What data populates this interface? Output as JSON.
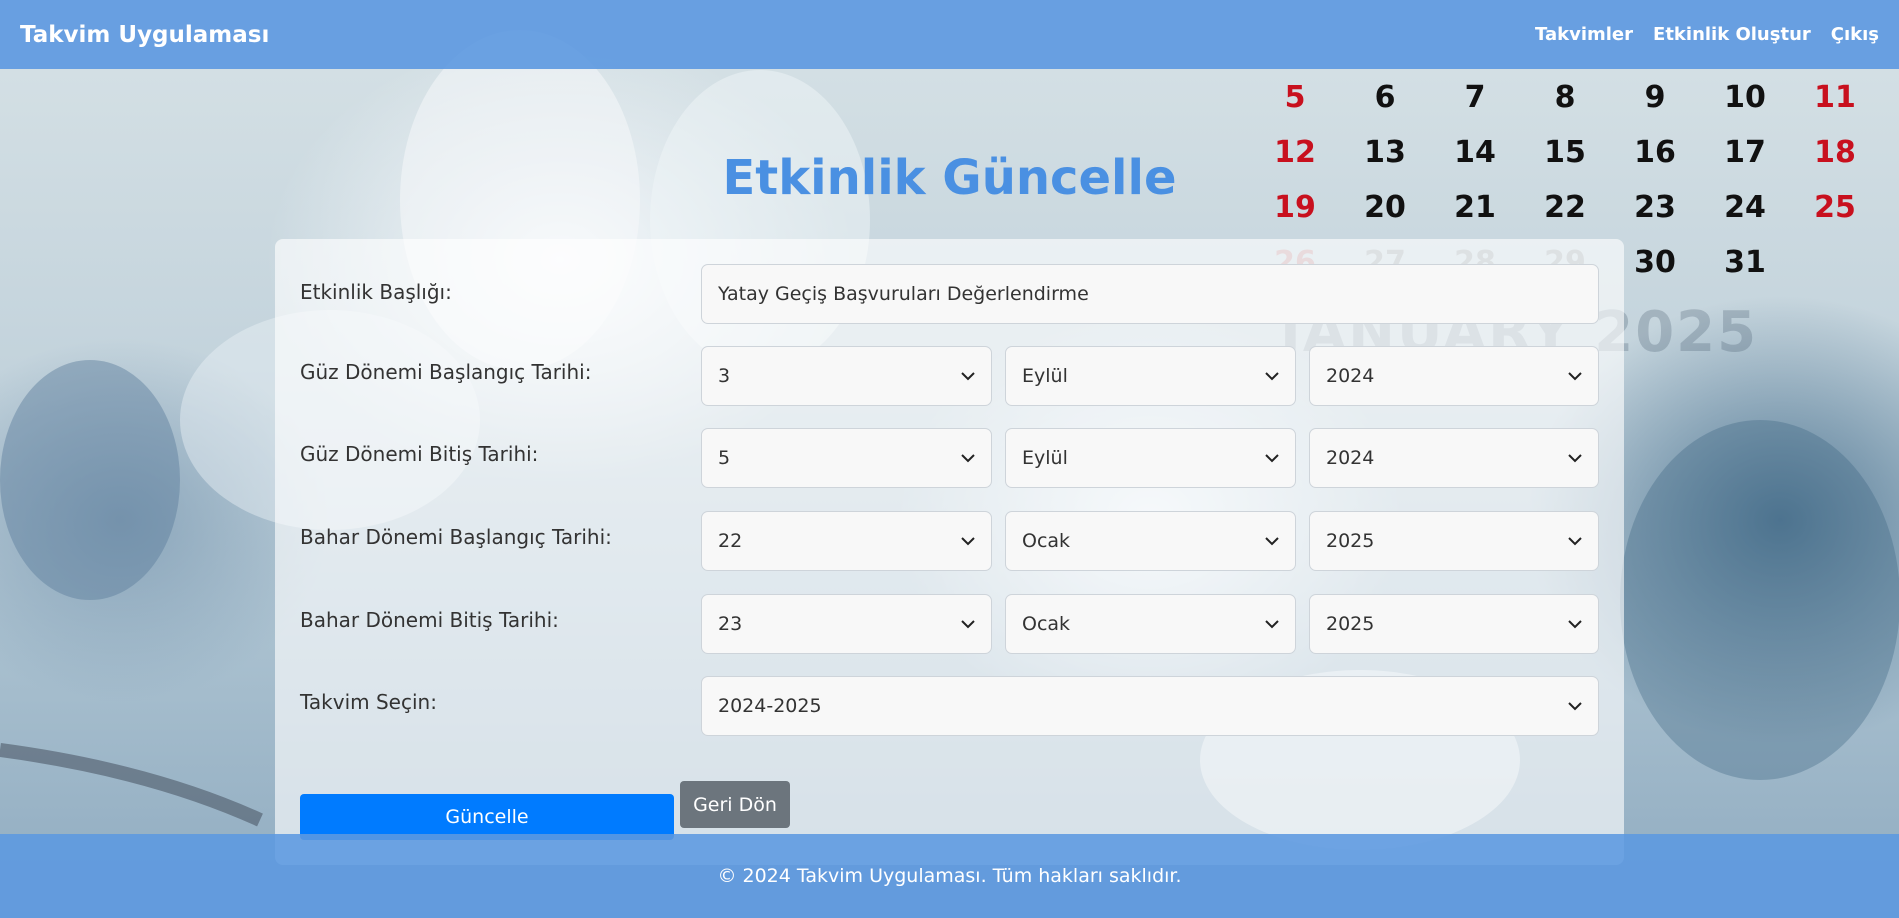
{
  "navbar": {
    "brand": "Takvim Uygulaması",
    "links": [
      "Takvimler",
      "Etkinlik Oluştur",
      "Çıkış"
    ]
  },
  "calendar": {
    "rows": [
      [
        "5",
        "6",
        "7",
        "8",
        "9",
        "10",
        "11"
      ],
      [
        "12",
        "13",
        "14",
        "15",
        "16",
        "17",
        "18"
      ],
      [
        "19",
        "20",
        "21",
        "22",
        "23",
        "24",
        "25"
      ],
      [
        "26",
        "27",
        "28",
        "29",
        "30",
        "31",
        ""
      ]
    ],
    "month_label": "JANUARY 2025"
  },
  "page": {
    "title": "Etkinlik Güncelle"
  },
  "form": {
    "title_label": "Etkinlik Başlığı:",
    "title_value": "Yatay Geçiş Başvuruları Değerlendirme",
    "fall_start_label": "Güz Dönemi Başlangıç Tarihi:",
    "fall_start": {
      "day": "3",
      "month": "Eylül",
      "year": "2024"
    },
    "fall_end_label": "Güz Dönemi Bitiş Tarihi:",
    "fall_end": {
      "day": "5",
      "month": "Eylül",
      "year": "2024"
    },
    "spring_start_label": "Bahar Dönemi Başlangıç Tarihi:",
    "spring_start": {
      "day": "22",
      "month": "Ocak",
      "year": "2025"
    },
    "spring_end_label": "Bahar Dönemi Bitiş Tarihi:",
    "spring_end": {
      "day": "23",
      "month": "Ocak",
      "year": "2025"
    },
    "calendar_label": "Takvim Seçin:",
    "calendar_value": "2024-2025",
    "update_button": "Güncelle",
    "back_button": "Geri Dön"
  },
  "footer": {
    "text": "© 2024 Takvim Uygulaması. Tüm hakları saklıdır."
  },
  "colors": {
    "navbar": "#5c98e0",
    "title": "#4a90e2",
    "primary_button": "#007bff",
    "secondary_button": "#6c757d",
    "weekend_red": "#c8101e"
  }
}
